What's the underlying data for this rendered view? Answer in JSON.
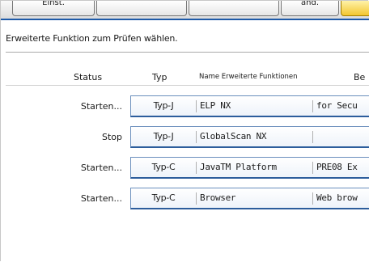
{
  "tabs": [
    {
      "label": "Einst."
    },
    {
      "label": ""
    },
    {
      "label": ""
    },
    {
      "label": "and."
    },
    {
      "label": ""
    }
  ],
  "instruction": "Erweiterte Funktion zum Prüfen wählen.",
  "columns": {
    "status": "Status",
    "type": "Typ",
    "name": "Name Erweiterte Funktionen",
    "description": "Be"
  },
  "rows": [
    {
      "status": "Starten...",
      "type": "Typ-J",
      "name": "ELP NX",
      "description": "for Secu"
    },
    {
      "status": "Stop",
      "type": "Typ-J",
      "name": "GlobalScan NX",
      "description": ""
    },
    {
      "status": "Starten...",
      "type": "Typ-C",
      "name": "JavaTM Platform",
      "description": "PRE08 Ex"
    },
    {
      "status": "Starten...",
      "type": "Typ-C",
      "name": "Browser",
      "description": "Web brow"
    }
  ],
  "colors": {
    "accent": "#1e5aa8",
    "active_tab": "#f3c630",
    "row_border": "#2c5d9c"
  }
}
